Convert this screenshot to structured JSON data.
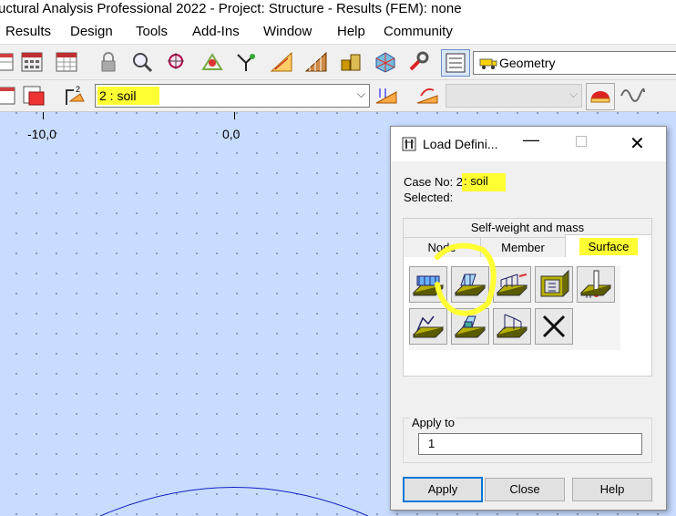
{
  "window": {
    "title": "uctural Analysis Professional 2022 - Project: Structure - Results (FEM): none"
  },
  "menu": [
    "Results",
    "Design",
    "Tools",
    "Add-Ins",
    "Window",
    "Help",
    "Community"
  ],
  "toolbar": {
    "layout_dropdown": "Geometry",
    "case_dropdown": "2 : soil",
    "disabled_dropdown": ""
  },
  "ruler": {
    "left_label": "-10,0",
    "mid_label": "0,0"
  },
  "dialog": {
    "title": "Load Defini...",
    "case_label": "Case No: 2",
    "case_value": ": soil",
    "selected_label": "Selected:",
    "tab_top": "Self-weight and mass",
    "tabs": [
      "Node",
      "Member",
      "Surface"
    ],
    "apply_to_label": "Apply to",
    "apply_to_value": "1",
    "buttons": {
      "apply": "Apply",
      "close": "Close",
      "help": "Help"
    }
  },
  "colors": {
    "canvas": "#c8dcff",
    "highlight": "#ffff33",
    "accent": "#0066cc"
  }
}
